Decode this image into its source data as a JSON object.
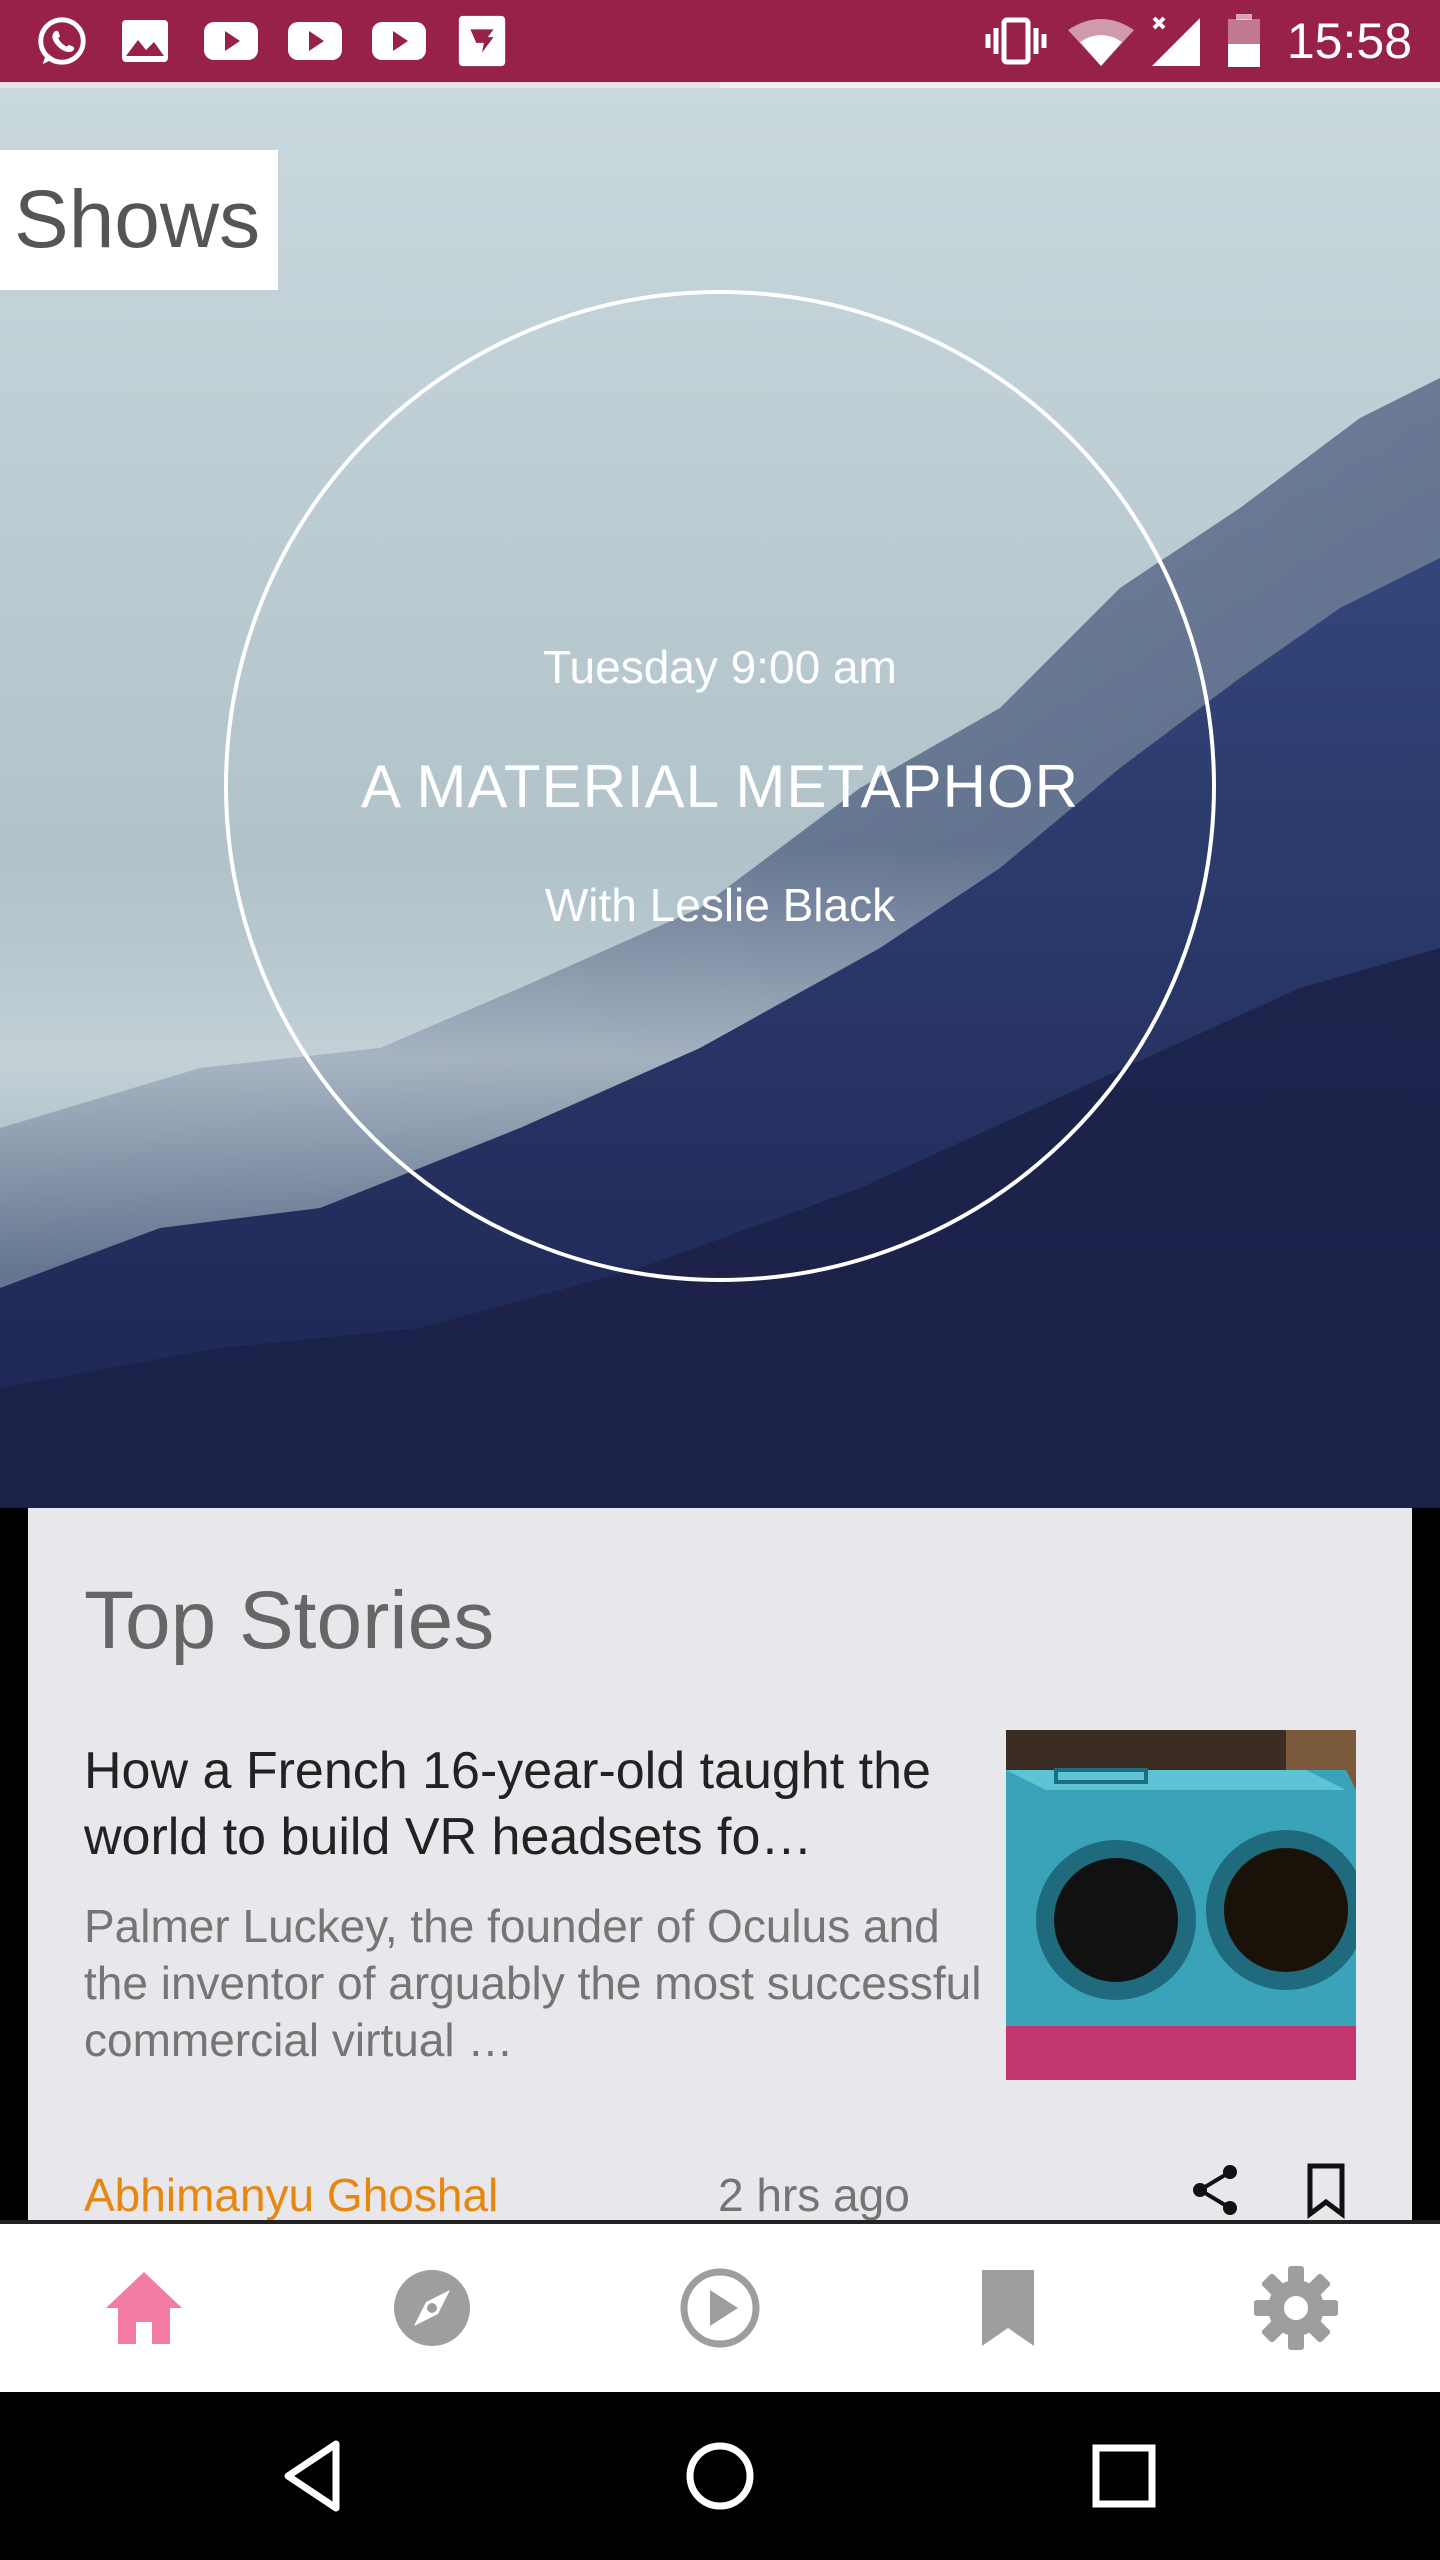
{
  "status_bar": {
    "time": "15:58",
    "left_icons": [
      "whatsapp-icon",
      "gallery-icon",
      "youtube-icon",
      "youtube-icon",
      "youtube-icon",
      "app-icon"
    ],
    "right_icons": [
      "vibrate-icon",
      "wifi-icon",
      "signal-icon",
      "battery-icon"
    ],
    "background": "#98214c"
  },
  "hero": {
    "tab_label": "Shows",
    "show": {
      "time": "Tuesday 9:00 am",
      "title": "A MATERIAL METAPHOR",
      "host": "With Leslie Black"
    }
  },
  "top_stories": {
    "title": "Top Stories",
    "story": {
      "headline": "How a French 16-year-old taught the world to build VR headsets fo…",
      "summary": "Palmer Luckey, the founder of Oculus and the inventor of arguably the most successful commercial virtual …",
      "author": "Abhimanyu Ghoshal",
      "time_ago": "2 hrs ago",
      "author_color": "#e8870f",
      "actions": [
        "share-icon",
        "bookmark-icon"
      ]
    }
  },
  "bottom_nav": {
    "items": [
      {
        "icon": "home-icon",
        "active": true
      },
      {
        "icon": "compass-icon",
        "active": false
      },
      {
        "icon": "play-icon",
        "active": false
      },
      {
        "icon": "bookmark-icon",
        "active": false
      },
      {
        "icon": "settings-icon",
        "active": false
      }
    ],
    "active_color": "#f37ba6",
    "inactive_color": "#999999"
  },
  "system_nav": {
    "buttons": [
      "back-icon",
      "home-circle-icon",
      "recents-icon"
    ]
  }
}
